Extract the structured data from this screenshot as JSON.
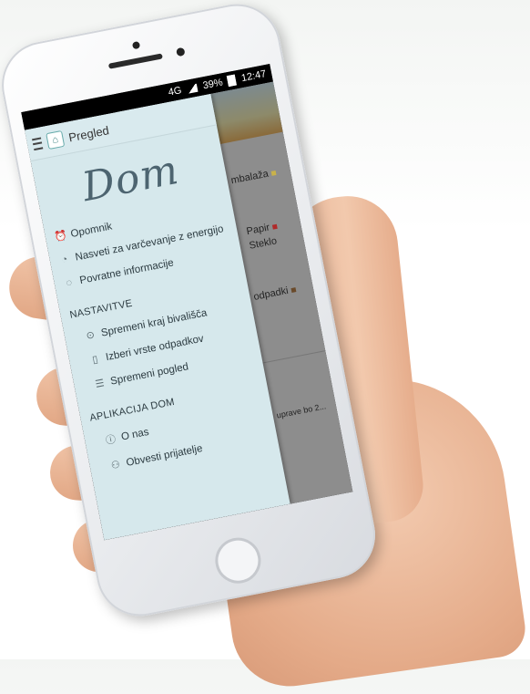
{
  "status_bar": {
    "network": "4G",
    "battery": "39%",
    "time": "12:47"
  },
  "topbar": {
    "title": "Pregled"
  },
  "logo": "Dom",
  "menu": {
    "items": [
      {
        "label": "Opomnik",
        "icon": "alarm-clock-icon"
      },
      {
        "label": "Nasveti za varčevanje z energijo",
        "icon": "piggy-bank-icon"
      },
      {
        "label": "Povratne informacije",
        "icon": "chat-bubble-icon"
      }
    ],
    "settings_title": "NASTAVITVE",
    "settings": [
      {
        "label": "Spremeni kraj bivališča",
        "icon": "location-pin-icon"
      },
      {
        "label": "Izberi vrste odpadkov",
        "icon": "trash-bin-icon"
      },
      {
        "label": "Spremeni pogled",
        "icon": "list-view-icon"
      }
    ],
    "app_title": "APLIKACIJA DOM",
    "app": [
      {
        "label": "O nas",
        "icon": "info-icon"
      },
      {
        "label": "Obvesti prijatelje",
        "icon": "people-icon"
      }
    ]
  },
  "behind": {
    "row1": "mbalaža",
    "row2a": "Papir",
    "row2b": "Steklo",
    "row3": "odpadki",
    "row4": "uprave bo 2..."
  },
  "colors": {
    "drawer_bg": "#d6e8ec",
    "logo": "#4d6470"
  }
}
